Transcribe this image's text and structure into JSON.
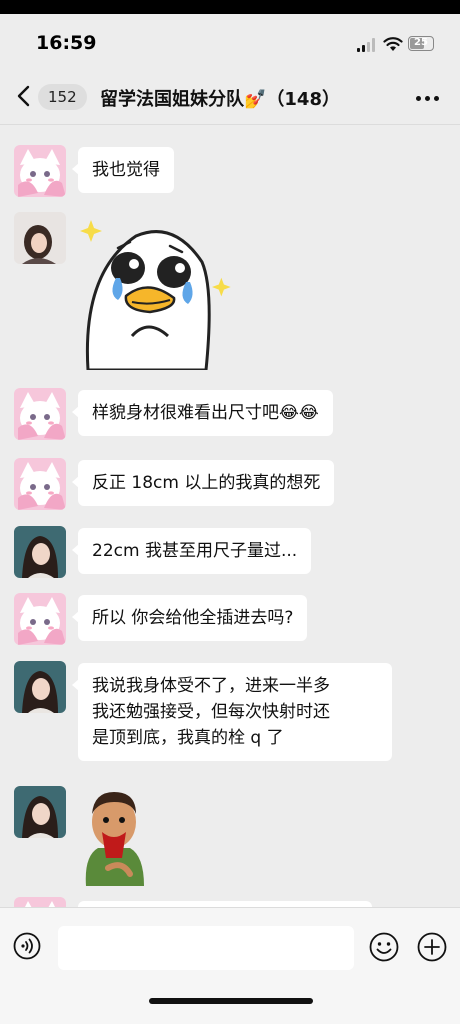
{
  "status": {
    "time": "16:59",
    "battery": "25"
  },
  "nav": {
    "unread_count": "152",
    "title": "留学法国姐妹分队💅（148）"
  },
  "messages": [
    {
      "sender": "pink-cat-avatar",
      "type": "text",
      "text": "我也觉得"
    },
    {
      "sender": "girl-avatar",
      "type": "sticker",
      "sticker": "crying-duck-sticker"
    },
    {
      "sender": "pink-cat-avatar",
      "type": "text",
      "text": "样貌身材很难看出尺寸吧😂😂"
    },
    {
      "sender": "pink-cat-avatar",
      "type": "text",
      "text": "反正 18cm 以上的我真的想死"
    },
    {
      "sender": "girl-avatar",
      "type": "text",
      "text": "22cm 我甚至用尺子量过..."
    },
    {
      "sender": "pink-cat-avatar",
      "type": "text",
      "text": "所以 你会给他全插进去吗?"
    },
    {
      "sender": "girl-avatar",
      "type": "text",
      "lines": [
        "我说我身体受不了，进来一半多",
        "我还勉强接受，但每次快射时还",
        "是顶到底，我真的栓 q 了"
      ]
    },
    {
      "sender": "girl-avatar",
      "type": "sticker",
      "sticker": "bleeding-cartoon-sticker"
    },
    {
      "sender": "pink-cat-avatar",
      "type": "text",
      "text": ""
    }
  ]
}
